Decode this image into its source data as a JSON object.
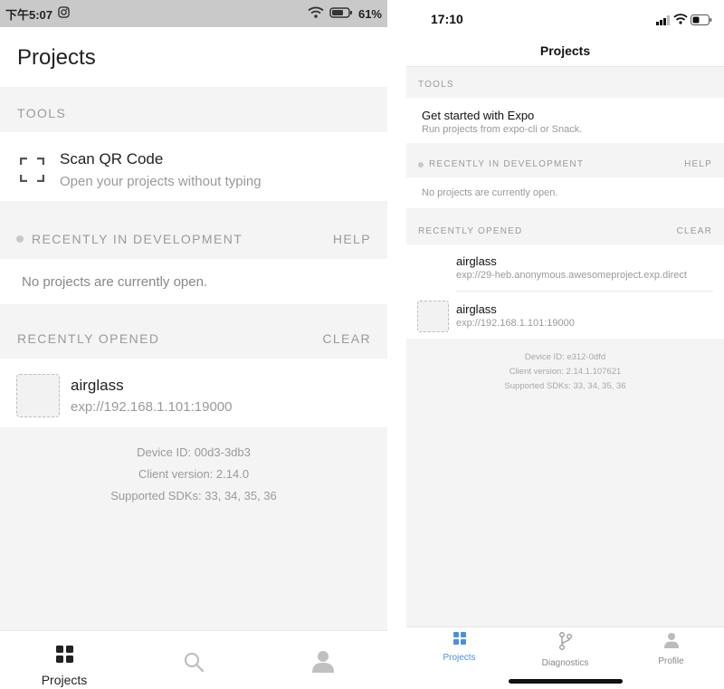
{
  "android": {
    "status_time": "下午5:07",
    "battery": "61%",
    "title": "Projects",
    "tools_label": "TOOLS",
    "scan_title": "Scan QR Code",
    "scan_subtitle": "Open your projects without typing",
    "recent_dev_label": "RECENTLY IN DEVELOPMENT",
    "help_label": "HELP",
    "no_projects": "No projects are currently open.",
    "recent_opened_label": "RECENTLY OPENED",
    "clear_label": "CLEAR",
    "project": {
      "name": "airglass",
      "url": "exp://192.168.1.101:19000"
    },
    "device_id": "Device ID: 00d3-3db3",
    "client_version": "Client version: 2.14.0",
    "sdks": "Supported SDKs: 33, 34, 35, 36",
    "tabs": [
      {
        "label": "Projects",
        "icon": "grid-icon"
      },
      {
        "label": "",
        "icon": "search-icon"
      },
      {
        "label": "",
        "icon": "person-icon"
      }
    ]
  },
  "ios": {
    "status_time": "17:10",
    "title": "Projects",
    "tools_label": "TOOLS",
    "get_started_title": "Get started with Expo",
    "get_started_subtitle": "Run projects from expo-cli or Snack.",
    "recent_dev_label": "RECENTLY IN DEVELOPMENT",
    "help_label": "HELP",
    "no_projects": "No projects are currently open.",
    "recent_opened_label": "RECENTLY OPENED",
    "clear_label": "CLEAR",
    "projects": [
      {
        "name": "airglass",
        "url": "exp://29-heb.anonymous.awesomeproject.exp.direct"
      },
      {
        "name": "airglass",
        "url": "exp://192.168.1.101:19000"
      }
    ],
    "device_id": "Device ID: e312-0dfd",
    "client_version": "Client version: 2.14.1.107621",
    "sdks": "Supported SDKs: 33, 34, 35, 36",
    "tabs": [
      {
        "label": "Projects",
        "icon": "grid-icon"
      },
      {
        "label": "Diagnostics",
        "icon": "branch-icon"
      },
      {
        "label": "Profile",
        "icon": "person-icon"
      }
    ],
    "active_color": "#4a90e2"
  }
}
